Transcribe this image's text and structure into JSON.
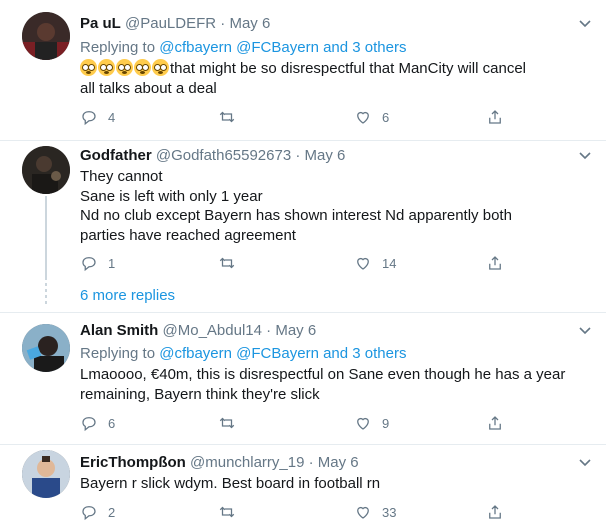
{
  "tweets": [
    {
      "name": "Pa uL",
      "handle": "@PauLDEFR",
      "dot": "·",
      "date": "May 6",
      "replying_prefix": "Replying to",
      "replying_to": [
        "@cfbayern",
        "@FCBayern"
      ],
      "replying_others": "and 3 others",
      "emoji_count": 5,
      "text_lines": [
        "that might be so disrespectful that ManCity will cancel",
        "all talks about a deal"
      ],
      "replies": "4",
      "retweets": "",
      "likes": "6"
    },
    {
      "name": "Godfather",
      "handle": "@Godfath65592673",
      "dot": "·",
      "date": "May 6",
      "text_lines": [
        "They cannot",
        "Sane is left with only 1 year",
        "Nd no club except Bayern has shown interest Nd apparently both",
        "parties have reached agreement"
      ],
      "replies": "1",
      "retweets": "",
      "likes": "14"
    },
    {
      "name": "Alan Smith",
      "handle": "@Mo_Abdul14",
      "dot": "·",
      "date": "May 6",
      "replying_prefix": "Replying to",
      "replying_to": [
        "@cfbayern",
        "@FCBayern"
      ],
      "replying_others": "and 3 others",
      "text_lines": [
        "Lmaoooo, €40m, this is disrespectful on Sane even though he has a year",
        "remaining, Bayern think they're slick"
      ],
      "replies": "6",
      "retweets": "",
      "likes": "9"
    },
    {
      "name": "EricThompßon",
      "handle": "@munchlarry_19",
      "dot": "·",
      "date": "May 6",
      "text_lines": [
        "Bayern r slick wdym. Best board in football rn"
      ],
      "replies": "2",
      "retweets": "",
      "likes": "33"
    }
  ],
  "thread": {
    "more_replies": "6 more replies"
  },
  "icons": [
    "reply-icon",
    "retweet-icon",
    "like-icon",
    "share-icon",
    "chevron-down-icon"
  ],
  "colors": {
    "link": "#1b95e0",
    "muted": "#657786",
    "text": "#14171a",
    "divider": "#e6ecf0"
  }
}
